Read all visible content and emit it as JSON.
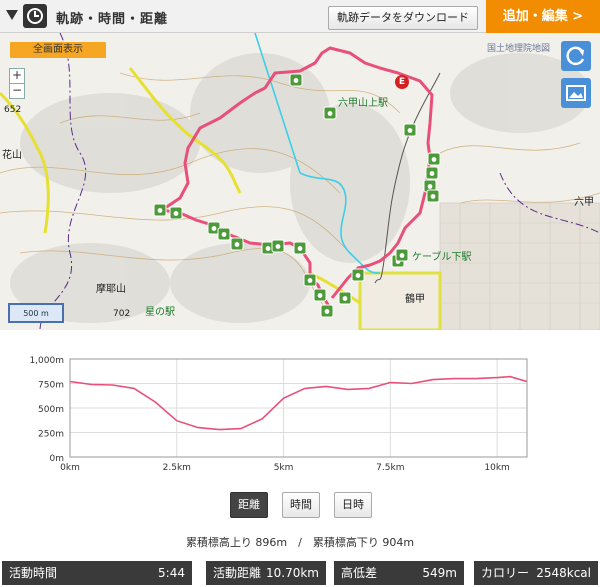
{
  "header": {
    "title": "軌跡・時間・距離",
    "download_label": "軌跡データをダウンロード",
    "add_edit_label": "追加・編集 >"
  },
  "map": {
    "fullscreen_label": "全画面表示",
    "zoom_in": "+",
    "zoom_out": "−",
    "source_label": "国土地理院地図",
    "scale_label": "500 m",
    "labels": {
      "rokko_station": "六甲山上駅",
      "cable_station": "ケーブル下駅",
      "tsurukabuto": "鶴甲",
      "maya": "摩耶山",
      "hoshi_station": "星の駅",
      "elev_702": "702",
      "elev_652": "652",
      "hanayama": "花山",
      "end_marker": "E",
      "rokko_right": "六甲"
    },
    "colors": {
      "track": "#e8507a",
      "road": "#e8e030",
      "river": "#30c8e0"
    }
  },
  "chart_data": {
    "type": "area",
    "x": [
      0,
      0.5,
      1,
      1.5,
      2,
      2.5,
      3,
      3.5,
      4,
      4.5,
      5,
      5.5,
      6,
      6.5,
      7,
      7.5,
      8,
      8.5,
      9,
      9.5,
      10,
      10.3,
      10.7
    ],
    "values": [
      770,
      740,
      735,
      700,
      560,
      370,
      300,
      280,
      290,
      390,
      600,
      700,
      720,
      690,
      700,
      760,
      750,
      790,
      800,
      800,
      810,
      820,
      770
    ],
    "xlabel": "",
    "ylabel": "",
    "xticks": [
      "0km",
      "2.5km",
      "5km",
      "7.5km",
      "10km"
    ],
    "yticks": [
      "0m",
      "250m",
      "500m",
      "750m",
      "1,000m"
    ],
    "xlim": [
      0,
      10.7
    ],
    "ylim": [
      0,
      1000
    ],
    "grid": true,
    "color": "#e8507a"
  },
  "toggles": {
    "distance": "距離",
    "time": "時間",
    "datetime": "日時"
  },
  "cumulative": "累積標高上り 896m　/　累積標高下り 904m",
  "stats": [
    {
      "label": "活動時間",
      "value": "5:44"
    },
    {
      "label": "活動距離",
      "value": "10.70km"
    },
    {
      "label": "高低差",
      "value": "549m"
    },
    {
      "label": "カロリー",
      "value": "2548kcal"
    }
  ]
}
